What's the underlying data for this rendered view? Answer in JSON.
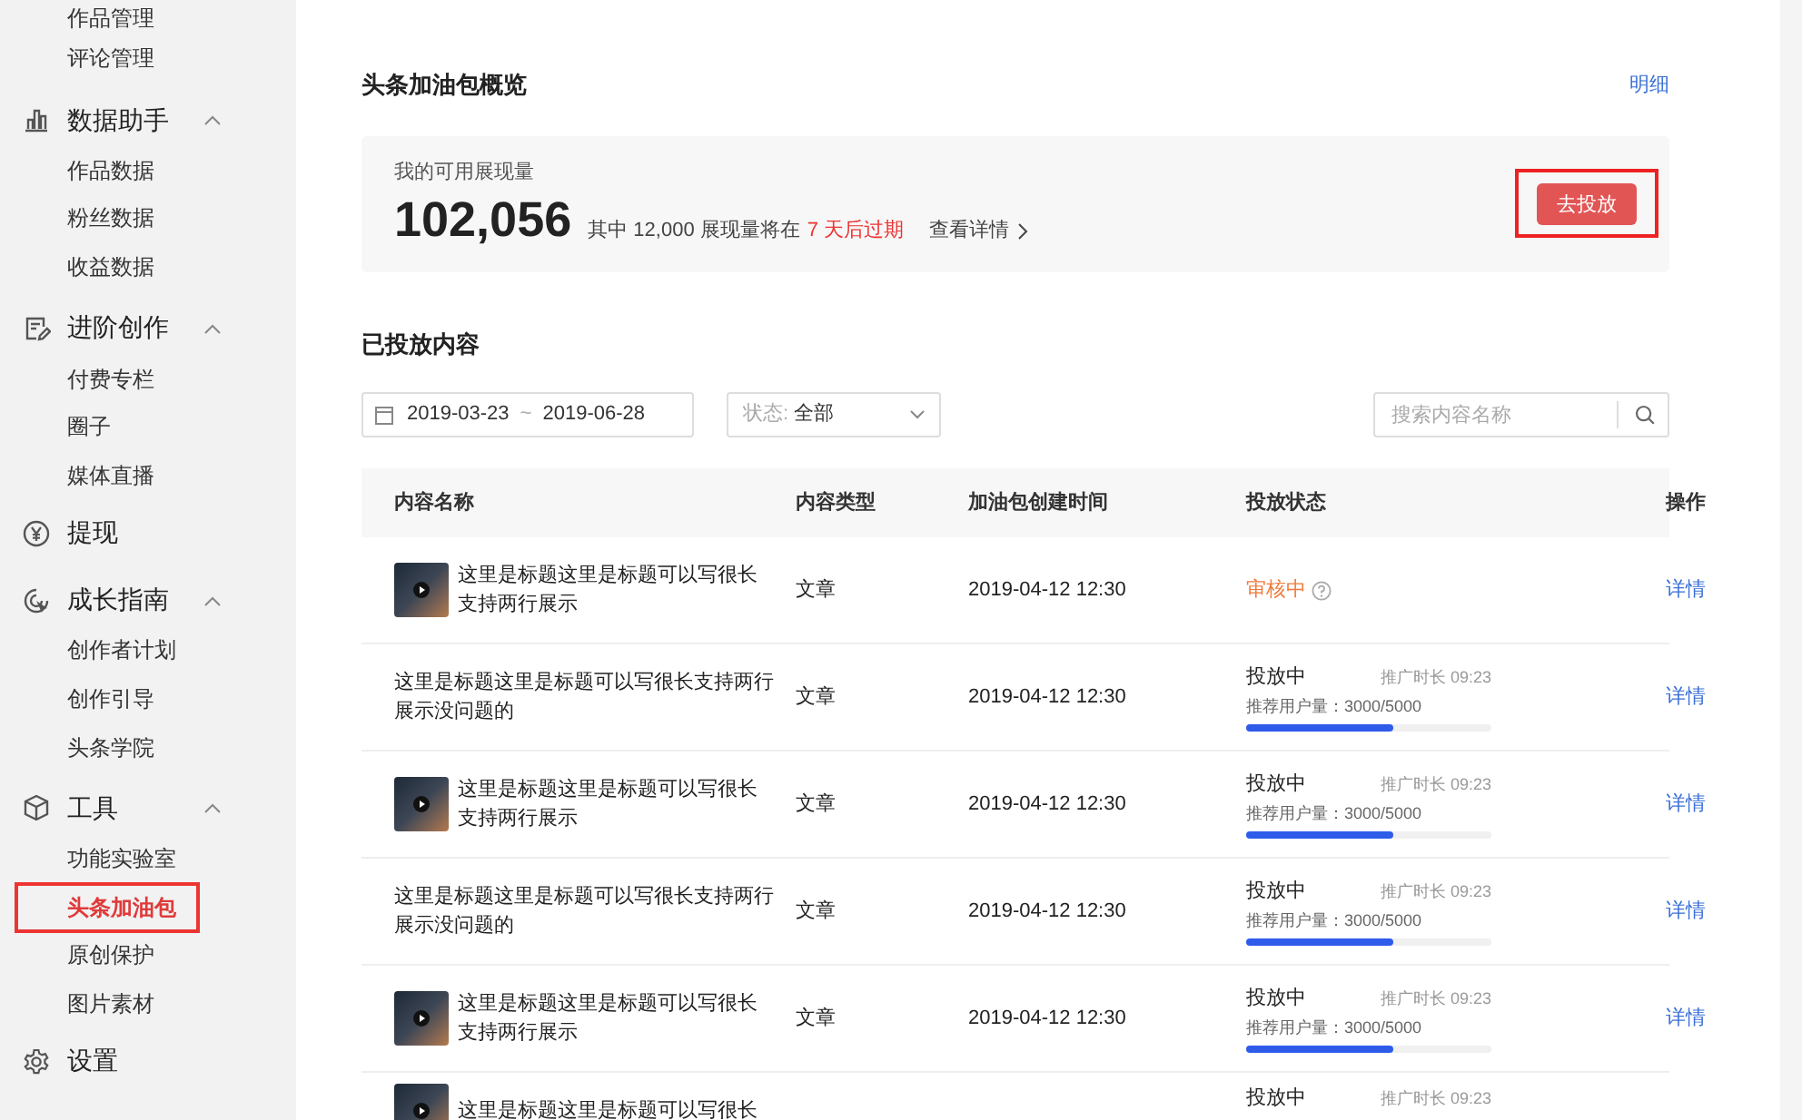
{
  "sidebar": {
    "groups": [
      {
        "items": [
          {
            "label": "作品管理",
            "selected": false
          },
          {
            "label": "评论管理",
            "selected": false
          }
        ]
      },
      {
        "label": "数据助手",
        "expanded": true,
        "items": [
          {
            "label": "作品数据",
            "selected": false
          },
          {
            "label": "粉丝数据",
            "selected": false
          },
          {
            "label": "收益数据",
            "selected": false
          }
        ]
      },
      {
        "label": "进阶创作",
        "expanded": true,
        "items": [
          {
            "label": "付费专栏",
            "selected": false
          },
          {
            "label": "圈子",
            "selected": false
          },
          {
            "label": "媒体直播",
            "selected": false
          }
        ]
      },
      {
        "label": "提现"
      },
      {
        "label": "成长指南",
        "expanded": true,
        "items": [
          {
            "label": "创作者计划",
            "selected": false
          },
          {
            "label": "创作引导",
            "selected": false
          },
          {
            "label": "头条学院",
            "selected": false
          }
        ]
      },
      {
        "label": "工具",
        "expanded": true,
        "items": [
          {
            "label": "功能实验室",
            "selected": false
          },
          {
            "label": "头条加油包",
            "selected": true
          },
          {
            "label": "原创保护",
            "selected": false
          },
          {
            "label": "图片素材",
            "selected": false
          }
        ]
      },
      {
        "label": "设置"
      }
    ]
  },
  "overview": {
    "title": "头条加油包概览",
    "detail_link": "明细",
    "stat_label": "我的可用展现量",
    "stat_value": "102,056",
    "expire_before": "其中 12,000 展现量将在",
    "expire_days": "7 天后过期",
    "view_link": "查看详情",
    "action_button": {
      "label": "去投放",
      "highlighted": true
    }
  },
  "delivered": {
    "title": "已投放内容",
    "date_start": "2019-03-23",
    "date_sep": "~",
    "date_end": "2019-06-28",
    "status_filter": {
      "label": "状态:",
      "value": "全部"
    },
    "search": {
      "placeholder": "搜索内容名称"
    }
  },
  "table": {
    "columns": [
      "内容名称",
      "内容类型",
      "加油包创建时间",
      "投放状态",
      "操作"
    ],
    "rows": [
      {
        "thumbnail": true,
        "title": "这里是标题这里是标题可以写很长支持两行展示",
        "type": "文章",
        "created": "2019-04-12 12:30",
        "status": {
          "kind": "review",
          "label": "审核中"
        },
        "action": "详情"
      },
      {
        "thumbnail": false,
        "title": "这里是标题这里是标题可以写很长支持两行展示没问题的",
        "type": "文章",
        "created": "2019-04-12 12:30",
        "status": {
          "kind": "running",
          "label": "投放中",
          "duration": "推广时长 09:23",
          "users": "推荐用户量：3000/5000",
          "level": 0.6
        },
        "action": "详情"
      },
      {
        "thumbnail": true,
        "title": "这里是标题这里是标题可以写很长支持两行展示",
        "type": "文章",
        "created": "2019-04-12 12:30",
        "status": {
          "kind": "running",
          "label": "投放中",
          "duration": "推广时长 09:23",
          "users": "推荐用户量：3000/5000",
          "level": 0.6
        },
        "action": "详情"
      },
      {
        "thumbnail": false,
        "title": "这里是标题这里是标题可以写很长支持两行展示没问题的",
        "type": "文章",
        "created": "2019-04-12 12:30",
        "status": {
          "kind": "running",
          "label": "投放中",
          "duration": "推广时长 09:23",
          "users": "推荐用户量：3000/5000",
          "level": 0.6
        },
        "action": "详情"
      },
      {
        "thumbnail": true,
        "title": "这里是标题这里是标题可以写很长支持两行展示",
        "type": "文章",
        "created": "2019-04-12 12:30",
        "status": {
          "kind": "running",
          "label": "投放中",
          "duration": "推广时长 09:23",
          "users": "推荐用户量：3000/5000",
          "level": 0.6
        },
        "action": "详情"
      },
      {
        "thumbnail": true,
        "title": "这里是标题这里是标题可以写很长",
        "status": {
          "kind": "running",
          "label": "投放中",
          "duration": "推广时长 09:23"
        }
      }
    ]
  }
}
